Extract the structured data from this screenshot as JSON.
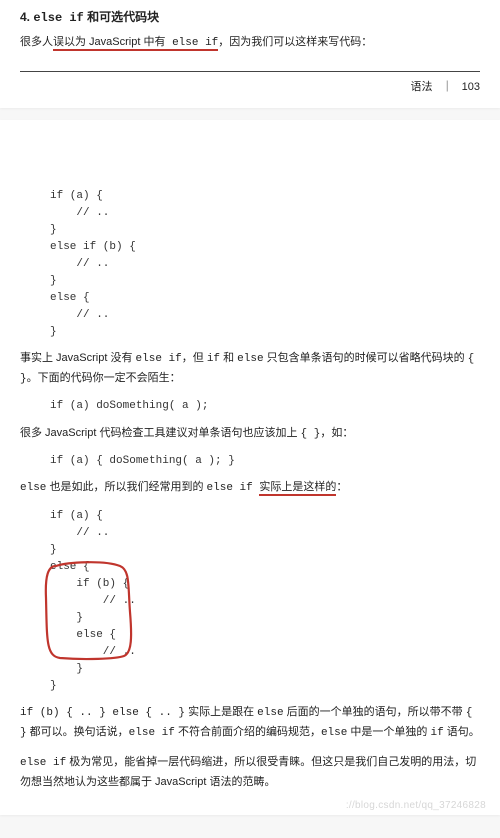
{
  "toppage": {
    "heading_prefix": "4. ",
    "heading_code": "else if",
    "heading_suffix": " 和可选代码块",
    "p1_a": "很多人",
    "p1_b": "误以为 JavaScript 中有",
    "p1_code": " else if",
    "p1_c": "，因为我们可以这样来写代码：",
    "footer_label": "语法",
    "footer_page": "103"
  },
  "bottompage": {
    "code1": "if (a) {\n    // ..\n}\nelse if (b) {\n    // ..\n}\nelse {\n    // ..\n}",
    "p2_a": "事实上 JavaScript 没有 ",
    "p2_code1": "else  if",
    "p2_b": "，但 ",
    "p2_code2": "if",
    "p2_c": " 和 ",
    "p2_code3": "else",
    "p2_d": " 只包含单条语句的时候可以省略代码块的 ",
    "p2_code4": "{ }",
    "p2_e": "。下面的代码你一定不会陌生：",
    "code2": "if (a) doSomething( a );",
    "p3_a": "很多 JavaScript 代码检查工具建议对单条语句也应该加上 ",
    "p3_code1": "{ }",
    "p3_b": "，如：",
    "code3": "if (a) { doSomething( a ); }",
    "p4_code1": "else",
    "p4_a": " 也是如此，所以我们经常用到的 ",
    "p4_code2": "else if ",
    "p4_b": "实际上是这样的",
    "p4_c": "：",
    "code4": "if (a) {\n    // ..\n}\nelse {\n    if (b) {\n        // ..\n    }\n    else {\n        // ..\n    }\n}",
    "p5_code1": "if (b) { .. } else { .. }",
    "p5_a": " 实际上是跟在 ",
    "p5_code2": "else",
    "p5_b": " 后面的一个单独的语句，所以带不带 ",
    "p5_code3": "{ }",
    "p5_c": " 都可以。换句话说，",
    "p5_code4": "else if",
    "p5_d": " 不符合前面介绍的编码规范，",
    "p5_code5": "else",
    "p5_e": " 中是一个单独的 ",
    "p5_code6": "if",
    "p5_f": " 语句。",
    "p6_code1": "else  if",
    "p6_a": " 极为常见，能省掉一层代码缩进，所以很受青睐。但这只是我们自己发明的用法，切勿想当然地认为这些都属于 JavaScript 语法的范畴。",
    "watermark": "://blog.csdn.net/qq_37246828"
  }
}
